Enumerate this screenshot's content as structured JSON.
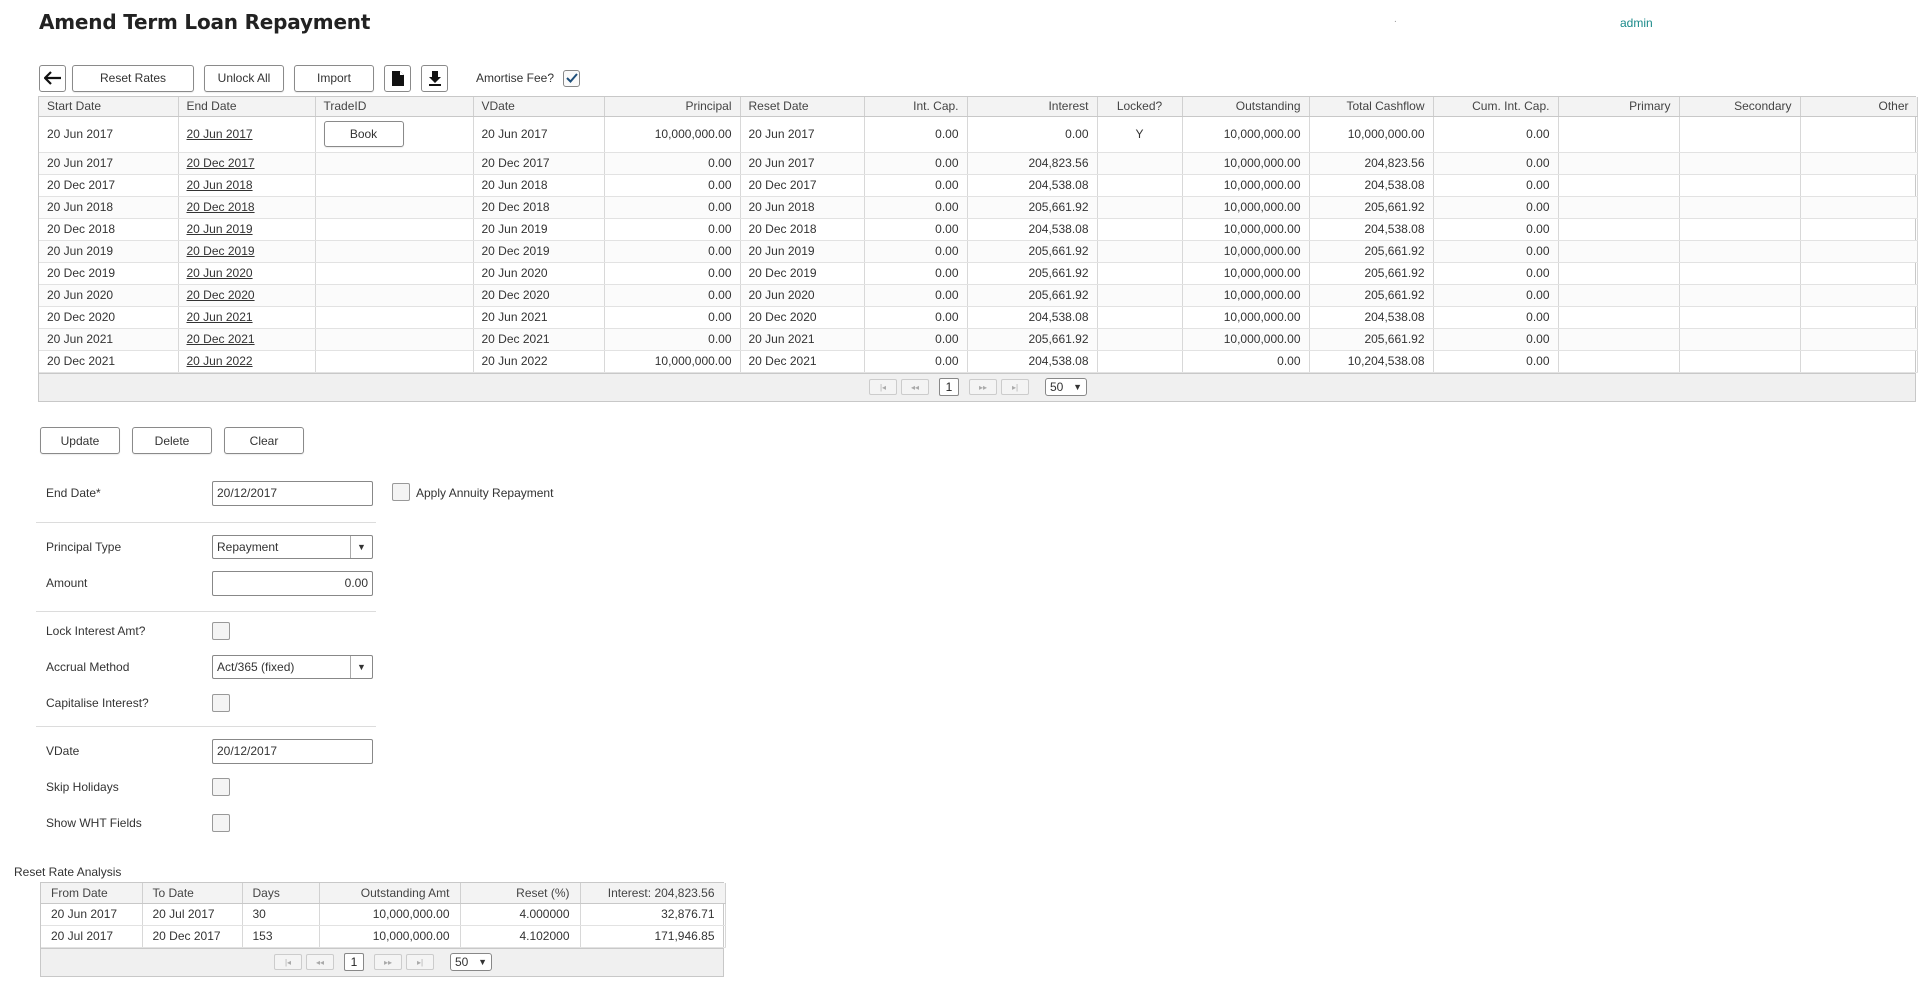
{
  "header": {
    "title": "Amend Term Loan Repayment",
    "dot": ".",
    "user": "admin"
  },
  "toolbar": {
    "reset_rates": "Reset Rates",
    "unlock_all": "Unlock All",
    "import": "Import",
    "amortise_label": "Amortise Fee?",
    "amortise_checked": true
  },
  "main_table": {
    "columns": [
      "Start Date",
      "End Date",
      "TradeID",
      "VDate",
      "Principal",
      "Reset Date",
      "Int. Cap.",
      "Interest",
      "Locked?",
      "Outstanding",
      "Total Cashflow",
      "Cum. Int. Cap.",
      "Primary",
      "Secondary",
      "Other"
    ],
    "book_label": "Book",
    "rows": [
      {
        "start": "20 Jun 2017",
        "end": "20 Jun 2017",
        "vdate": "20 Jun 2017",
        "principal": "10,000,000.00",
        "reset": "20 Jun 2017",
        "intcap": "0.00",
        "interest": "0.00",
        "locked": "Y",
        "outstanding": "10,000,000.00",
        "total": "10,000,000.00",
        "cum": "0.00"
      },
      {
        "start": "20 Jun 2017",
        "end": "20 Dec 2017",
        "vdate": "20 Dec 2017",
        "principal": "0.00",
        "reset": "20 Jun 2017",
        "intcap": "0.00",
        "interest": "204,823.56",
        "locked": "",
        "outstanding": "10,000,000.00",
        "total": "204,823.56",
        "cum": "0.00"
      },
      {
        "start": "20 Dec 2017",
        "end": "20 Jun 2018",
        "vdate": "20 Jun 2018",
        "principal": "0.00",
        "reset": "20 Dec 2017",
        "intcap": "0.00",
        "interest": "204,538.08",
        "locked": "",
        "outstanding": "10,000,000.00",
        "total": "204,538.08",
        "cum": "0.00"
      },
      {
        "start": "20 Jun 2018",
        "end": "20 Dec 2018",
        "vdate": "20 Dec 2018",
        "principal": "0.00",
        "reset": "20 Jun 2018",
        "intcap": "0.00",
        "interest": "205,661.92",
        "locked": "",
        "outstanding": "10,000,000.00",
        "total": "205,661.92",
        "cum": "0.00"
      },
      {
        "start": "20 Dec 2018",
        "end": "20 Jun 2019",
        "vdate": "20 Jun 2019",
        "principal": "0.00",
        "reset": "20 Dec 2018",
        "intcap": "0.00",
        "interest": "204,538.08",
        "locked": "",
        "outstanding": "10,000,000.00",
        "total": "204,538.08",
        "cum": "0.00"
      },
      {
        "start": "20 Jun 2019",
        "end": "20 Dec 2019",
        "vdate": "20 Dec 2019",
        "principal": "0.00",
        "reset": "20 Jun 2019",
        "intcap": "0.00",
        "interest": "205,661.92",
        "locked": "",
        "outstanding": "10,000,000.00",
        "total": "205,661.92",
        "cum": "0.00"
      },
      {
        "start": "20 Dec 2019",
        "end": "20 Jun 2020",
        "vdate": "20 Jun 2020",
        "principal": "0.00",
        "reset": "20 Dec 2019",
        "intcap": "0.00",
        "interest": "205,661.92",
        "locked": "",
        "outstanding": "10,000,000.00",
        "total": "205,661.92",
        "cum": "0.00"
      },
      {
        "start": "20 Jun 2020",
        "end": "20 Dec 2020",
        "vdate": "20 Dec 2020",
        "principal": "0.00",
        "reset": "20 Jun 2020",
        "intcap": "0.00",
        "interest": "205,661.92",
        "locked": "",
        "outstanding": "10,000,000.00",
        "total": "205,661.92",
        "cum": "0.00"
      },
      {
        "start": "20 Dec 2020",
        "end": "20 Jun 2021",
        "vdate": "20 Jun 2021",
        "principal": "0.00",
        "reset": "20 Dec 2020",
        "intcap": "0.00",
        "interest": "204,538.08",
        "locked": "",
        "outstanding": "10,000,000.00",
        "total": "204,538.08",
        "cum": "0.00"
      },
      {
        "start": "20 Jun 2021",
        "end": "20 Dec 2021",
        "vdate": "20 Dec 2021",
        "principal": "0.00",
        "reset": "20 Jun 2021",
        "intcap": "0.00",
        "interest": "205,661.92",
        "locked": "",
        "outstanding": "10,000,000.00",
        "total": "205,661.92",
        "cum": "0.00"
      },
      {
        "start": "20 Dec 2021",
        "end": "20 Jun 2022",
        "vdate": "20 Jun 2022",
        "principal": "10,000,000.00",
        "reset": "20 Dec 2021",
        "intcap": "0.00",
        "interest": "204,538.08",
        "locked": "",
        "outstanding": "0.00",
        "total": "10,204,538.08",
        "cum": "0.00"
      }
    ],
    "pager": {
      "current_page": "1",
      "page_size": "50"
    }
  },
  "actions": {
    "update": "Update",
    "delete": "Delete",
    "clear": "Clear"
  },
  "form": {
    "end_date_label": "End Date*",
    "end_date_value": "20/12/2017",
    "annuity_label": "Apply Annuity Repayment",
    "principal_type_label": "Principal Type",
    "principal_type_value": "Repayment",
    "amount_label": "Amount",
    "amount_value": "0.00",
    "lock_interest_label": "Lock Interest Amt?",
    "accrual_label": "Accrual Method",
    "accrual_value": "Act/365 (fixed)",
    "capitalise_label": "Capitalise Interest?",
    "vdate_label": "VDate",
    "vdate_value": "20/12/2017",
    "skip_holidays_label": "Skip Holidays",
    "show_wht_label": "Show WHT Fields"
  },
  "reset_rate": {
    "title": "Reset Rate Analysis",
    "columns": [
      "From Date",
      "To Date",
      "Days",
      "Outstanding Amt",
      "Reset (%)",
      "Interest: 204,823.56"
    ],
    "rows": [
      {
        "from": "20 Jun 2017",
        "to": "20 Jul 2017",
        "days": "30",
        "outstanding": "10,000,000.00",
        "reset": "4.000000",
        "interest": "32,876.71"
      },
      {
        "from": "20 Jul 2017",
        "to": "20 Dec 2017",
        "days": "153",
        "outstanding": "10,000,000.00",
        "reset": "4.102000",
        "interest": "171,946.85"
      }
    ],
    "pager": {
      "current_page": "1",
      "page_size": "50"
    }
  },
  "colors": {
    "accent_link": "#1a8a8a",
    "check_mark": "#1f4f7a"
  }
}
